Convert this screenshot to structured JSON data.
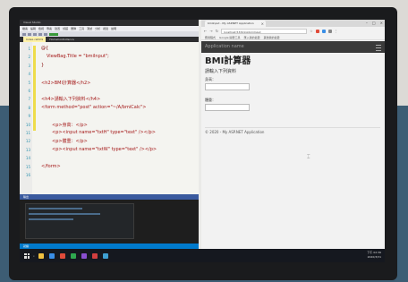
{
  "vs": {
    "title": "Visual Studio",
    "menu": [
      "檔案",
      "編輯",
      "檢視",
      "專案",
      "建置",
      "偵錯",
      "團隊",
      "工具",
      "測試",
      "分析",
      "視窗",
      "說明"
    ],
    "tabs": [
      "Index.cshtml",
      "HomeController.cs"
    ],
    "code_lines": [
      {
        "num": "1",
        "text": "@{",
        "cls": "c-dark"
      },
      {
        "num": "2",
        "text": "ViewBag.Title = \"bmiInput\";",
        "cls": "c-red"
      },
      {
        "num": "3",
        "text": "}",
        "cls": "c-dark"
      },
      {
        "num": "4",
        "text": "",
        "cls": "c-dark"
      },
      {
        "num": "5",
        "text": "<h2>BMI計算器</h2>",
        "cls": "c-maroon"
      },
      {
        "num": "6",
        "text": "",
        "cls": "c-dark"
      },
      {
        "num": "7",
        "text": "<h4>請輸入下列資料</h4>",
        "cls": "c-maroon"
      },
      {
        "num": "8",
        "text": "<form method=\"post\" action=\"~/A/bmiCalc\">",
        "cls": "c-maroon"
      },
      {
        "num": "9",
        "text": "",
        "cls": "c-dark"
      },
      {
        "num": "10",
        "text": "<p>身高：</p>",
        "cls": "c-maroon"
      },
      {
        "num": "11",
        "text": "<p><input name=\"txtH\" type=\"text\" /></p>",
        "cls": "c-maroon"
      },
      {
        "num": "12",
        "text": "<p>體重：</p>",
        "cls": "c-maroon"
      },
      {
        "num": "13",
        "text": "<p><input name=\"txtW\" type=\"text\" /></p>",
        "cls": "c-maroon"
      },
      {
        "num": "14",
        "text": "",
        "cls": "c-dark"
      },
      {
        "num": "15",
        "text": "</form>",
        "cls": "c-maroon"
      },
      {
        "num": "16",
        "text": "",
        "cls": "c-dark"
      }
    ],
    "output_title": "輸出",
    "status": "就緒"
  },
  "browser": {
    "tab_title": "bmiInput - My ASP.NET Application",
    "url": "localhost:53341/A/bmiInput",
    "bookmarks": [
      "應用程式",
      "Google 開發工具",
      "匯入我的最愛",
      "其他我的最愛"
    ],
    "app_name": "Application name",
    "heading": "BMI計算器",
    "subheading": "請輸入下列資料",
    "height_label": "身高：",
    "weight_label": "體重：",
    "footer": "© 2020 - My ASP.NET Application"
  },
  "taskbar": {
    "items": [
      {
        "label": "",
        "color": "#f0c040"
      },
      {
        "label": "",
        "color": "#3a8ee6"
      },
      {
        "label": "",
        "color": "#e04b3a"
      },
      {
        "label": "",
        "color": "#2fa84f"
      },
      {
        "label": "",
        "color": "#8a4fd0"
      },
      {
        "label": "",
        "color": "#d23f3f"
      },
      {
        "label": "",
        "color": "#3fa0d2"
      }
    ],
    "time": "下午 02:36",
    "date": "2020/3/31"
  }
}
